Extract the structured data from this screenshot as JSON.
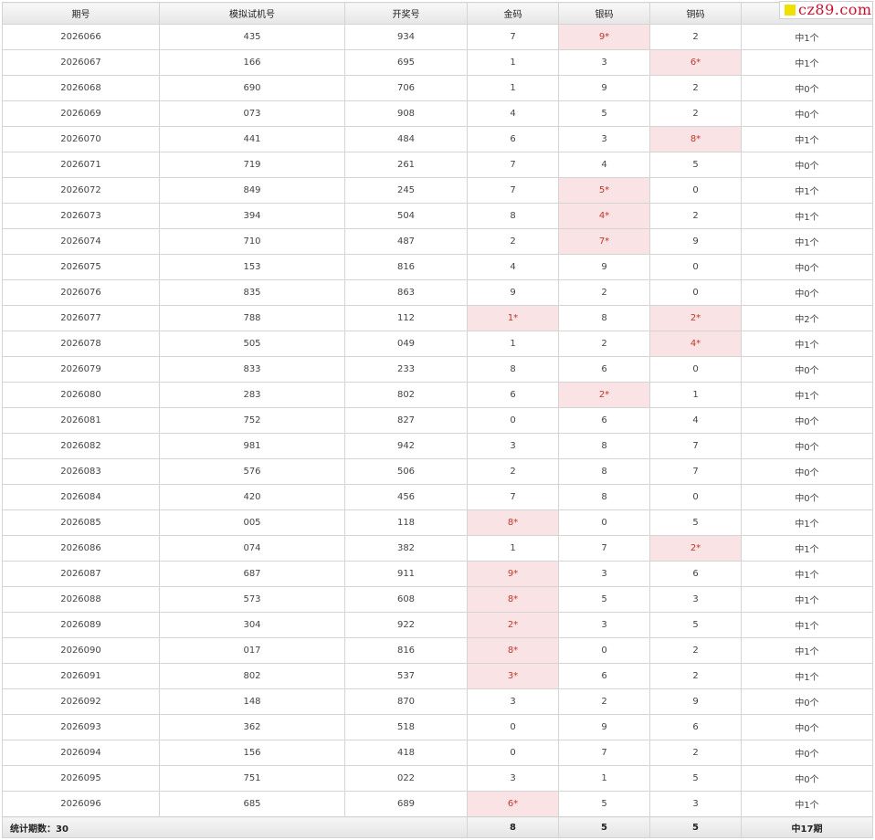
{
  "headers": [
    "期号",
    "模拟试机号",
    "开奖号",
    "金码",
    "银码",
    "铜码",
    ""
  ],
  "logo_text": "cz89.com",
  "hit_color": "#f9e3e4",
  "rows": [
    {
      "period": "2026066",
      "sim": "435",
      "draw": "934",
      "gold": "7",
      "silver": "9*",
      "bronze": "2",
      "result": "中1个"
    },
    {
      "period": "2026067",
      "sim": "166",
      "draw": "695",
      "gold": "1",
      "silver": "3",
      "bronze": "6*",
      "result": "中1个"
    },
    {
      "period": "2026068",
      "sim": "690",
      "draw": "706",
      "gold": "1",
      "silver": "9",
      "bronze": "2",
      "result": "中0个"
    },
    {
      "period": "2026069",
      "sim": "073",
      "draw": "908",
      "gold": "4",
      "silver": "5",
      "bronze": "2",
      "result": "中0个"
    },
    {
      "period": "2026070",
      "sim": "441",
      "draw": "484",
      "gold": "6",
      "silver": "3",
      "bronze": "8*",
      "result": "中1个"
    },
    {
      "period": "2026071",
      "sim": "719",
      "draw": "261",
      "gold": "7",
      "silver": "4",
      "bronze": "5",
      "result": "中0个"
    },
    {
      "period": "2026072",
      "sim": "849",
      "draw": "245",
      "gold": "7",
      "silver": "5*",
      "bronze": "0",
      "result": "中1个"
    },
    {
      "period": "2026073",
      "sim": "394",
      "draw": "504",
      "gold": "8",
      "silver": "4*",
      "bronze": "2",
      "result": "中1个"
    },
    {
      "period": "2026074",
      "sim": "710",
      "draw": "487",
      "gold": "2",
      "silver": "7*",
      "bronze": "9",
      "result": "中1个"
    },
    {
      "period": "2026075",
      "sim": "153",
      "draw": "816",
      "gold": "4",
      "silver": "9",
      "bronze": "0",
      "result": "中0个"
    },
    {
      "period": "2026076",
      "sim": "835",
      "draw": "863",
      "gold": "9",
      "silver": "2",
      "bronze": "0",
      "result": "中0个"
    },
    {
      "period": "2026077",
      "sim": "788",
      "draw": "112",
      "gold": "1*",
      "silver": "8",
      "bronze": "2*",
      "result": "中2个"
    },
    {
      "period": "2026078",
      "sim": "505",
      "draw": "049",
      "gold": "1",
      "silver": "2",
      "bronze": "4*",
      "result": "中1个"
    },
    {
      "period": "2026079",
      "sim": "833",
      "draw": "233",
      "gold": "8",
      "silver": "6",
      "bronze": "0",
      "result": "中0个"
    },
    {
      "period": "2026080",
      "sim": "283",
      "draw": "802",
      "gold": "6",
      "silver": "2*",
      "bronze": "1",
      "result": "中1个"
    },
    {
      "period": "2026081",
      "sim": "752",
      "draw": "827",
      "gold": "0",
      "silver": "6",
      "bronze": "4",
      "result": "中0个"
    },
    {
      "period": "2026082",
      "sim": "981",
      "draw": "942",
      "gold": "3",
      "silver": "8",
      "bronze": "7",
      "result": "中0个"
    },
    {
      "period": "2026083",
      "sim": "576",
      "draw": "506",
      "gold": "2",
      "silver": "8",
      "bronze": "7",
      "result": "中0个"
    },
    {
      "period": "2026084",
      "sim": "420",
      "draw": "456",
      "gold": "7",
      "silver": "8",
      "bronze": "0",
      "result": "中0个"
    },
    {
      "period": "2026085",
      "sim": "005",
      "draw": "118",
      "gold": "8*",
      "silver": "0",
      "bronze": "5",
      "result": "中1个"
    },
    {
      "period": "2026086",
      "sim": "074",
      "draw": "382",
      "gold": "1",
      "silver": "7",
      "bronze": "2*",
      "result": "中1个"
    },
    {
      "period": "2026087",
      "sim": "687",
      "draw": "911",
      "gold": "9*",
      "silver": "3",
      "bronze": "6",
      "result": "中1个"
    },
    {
      "period": "2026088",
      "sim": "573",
      "draw": "608",
      "gold": "8*",
      "silver": "5",
      "bronze": "3",
      "result": "中1个"
    },
    {
      "period": "2026089",
      "sim": "304",
      "draw": "922",
      "gold": "2*",
      "silver": "3",
      "bronze": "5",
      "result": "中1个"
    },
    {
      "period": "2026090",
      "sim": "017",
      "draw": "816",
      "gold": "8*",
      "silver": "0",
      "bronze": "2",
      "result": "中1个"
    },
    {
      "period": "2026091",
      "sim": "802",
      "draw": "537",
      "gold": "3*",
      "silver": "6",
      "bronze": "2",
      "result": "中1个"
    },
    {
      "period": "2026092",
      "sim": "148",
      "draw": "870",
      "gold": "3",
      "silver": "2",
      "bronze": "9",
      "result": "中0个"
    },
    {
      "period": "2026093",
      "sim": "362",
      "draw": "518",
      "gold": "0",
      "silver": "9",
      "bronze": "6",
      "result": "中0个"
    },
    {
      "period": "2026094",
      "sim": "156",
      "draw": "418",
      "gold": "0",
      "silver": "7",
      "bronze": "2",
      "result": "中0个"
    },
    {
      "period": "2026095",
      "sim": "751",
      "draw": "022",
      "gold": "3",
      "silver": "1",
      "bronze": "5",
      "result": "中0个"
    },
    {
      "period": "2026096",
      "sim": "685",
      "draw": "689",
      "gold": "6*",
      "silver": "5",
      "bronze": "3",
      "result": "中1个"
    }
  ],
  "footer": {
    "label": "统计期数：30",
    "gold": "8",
    "silver": "5",
    "bronze": "5",
    "result": "中17期"
  }
}
